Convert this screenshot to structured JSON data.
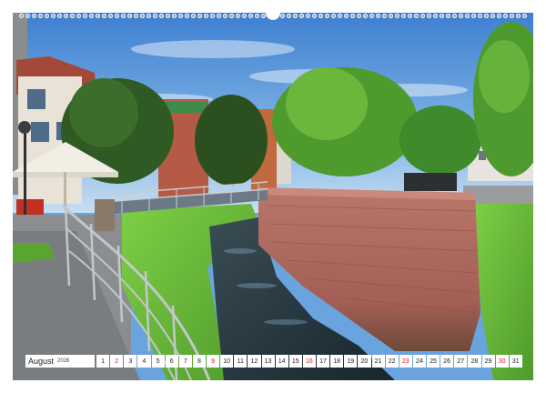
{
  "calendar": {
    "month": "August",
    "year": "2026",
    "days": [
      {
        "n": "1",
        "sun": false
      },
      {
        "n": "2",
        "sun": true
      },
      {
        "n": "3",
        "sun": false
      },
      {
        "n": "4",
        "sun": false
      },
      {
        "n": "5",
        "sun": false
      },
      {
        "n": "6",
        "sun": false
      },
      {
        "n": "7",
        "sun": false
      },
      {
        "n": "8",
        "sun": false
      },
      {
        "n": "9",
        "sun": true
      },
      {
        "n": "10",
        "sun": false
      },
      {
        "n": "11",
        "sun": false
      },
      {
        "n": "12",
        "sun": false
      },
      {
        "n": "13",
        "sun": false
      },
      {
        "n": "14",
        "sun": false
      },
      {
        "n": "15",
        "sun": false
      },
      {
        "n": "16",
        "sun": true
      },
      {
        "n": "17",
        "sun": false
      },
      {
        "n": "18",
        "sun": false
      },
      {
        "n": "19",
        "sun": false
      },
      {
        "n": "20",
        "sun": false
      },
      {
        "n": "21",
        "sun": false
      },
      {
        "n": "22",
        "sun": false
      },
      {
        "n": "23",
        "sun": true
      },
      {
        "n": "24",
        "sun": false
      },
      {
        "n": "25",
        "sun": false
      },
      {
        "n": "26",
        "sun": false
      },
      {
        "n": "27",
        "sun": false
      },
      {
        "n": "28",
        "sun": false
      },
      {
        "n": "29",
        "sun": false
      },
      {
        "n": "30",
        "sun": true
      },
      {
        "n": "31",
        "sun": false
      }
    ]
  },
  "colors": {
    "sunday": "#d11f1f",
    "weekday": "#222222",
    "sky": "#5a97da",
    "grass": "#6fbf3a",
    "sandstone_wall": "#b0675a",
    "water": "#22323a",
    "railing": "#b8bcc0"
  }
}
